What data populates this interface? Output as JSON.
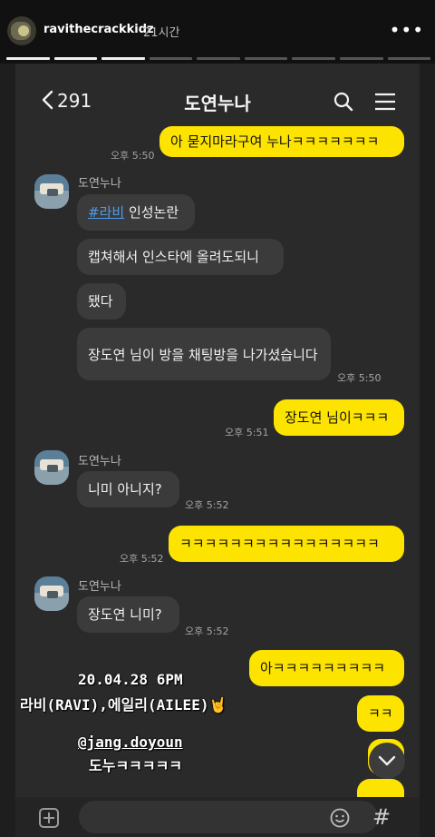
{
  "story": {
    "username": "ravithecrackkidz",
    "time_ago": "21시간",
    "menu": "•••",
    "progress_segments": 9,
    "progress_done": 3
  },
  "chat": {
    "back_count": "291",
    "title": "도연누나",
    "messages": [
      {
        "side": "mine",
        "text": "아 묻지마라구여 누나ㅋㅋㅋㅋㅋㅋㅋ",
        "time": "오후 5:50"
      },
      {
        "side": "theirs",
        "sender": "도연누나",
        "hashtag": "#라비",
        "text": " 인성논란"
      },
      {
        "side": "theirs",
        "text": "캡쳐해서 인스타에 올려도되니"
      },
      {
        "side": "theirs",
        "text": "됐다"
      },
      {
        "side": "theirs",
        "text": "장도연 님이 방을 채팅방을 나가셨습니다",
        "time": "오후 5:50"
      },
      {
        "side": "mine",
        "text": "장도연 님이ㅋㅋㅋ",
        "time": "오후 5:51"
      },
      {
        "side": "theirs",
        "sender": "도연누나",
        "text": "니미 아니지?",
        "time": "오후 5:52"
      },
      {
        "side": "mine",
        "text": "ㅋㅋㅋㅋㅋㅋㅋㅋㅋㅋㅋㅋㅋㅋㅋㅋ",
        "time": "오후 5:52"
      },
      {
        "side": "theirs",
        "sender": "도연누나",
        "text": "장도연 니미?",
        "time": "오후 5:52"
      },
      {
        "side": "mine",
        "text": "아ㅋㅋㅋㅋㅋㅋㅋㅋㅋ"
      },
      {
        "side": "mine",
        "text": "ㅋㅋ"
      }
    ]
  },
  "overlay": {
    "line1": "20.04.28 6PM",
    "line2": "라비(RAVI),에일리(AILEE)🤘",
    "mention": "@jang.doyoun",
    "line4": "도누ㅋㅋㅋㅋㅋ"
  },
  "colors": {
    "mine_bubble": "#fde400",
    "theirs_bubble": "#3b3b3b",
    "background": "#2a2a2a",
    "hashtag": "#4d9be8"
  }
}
